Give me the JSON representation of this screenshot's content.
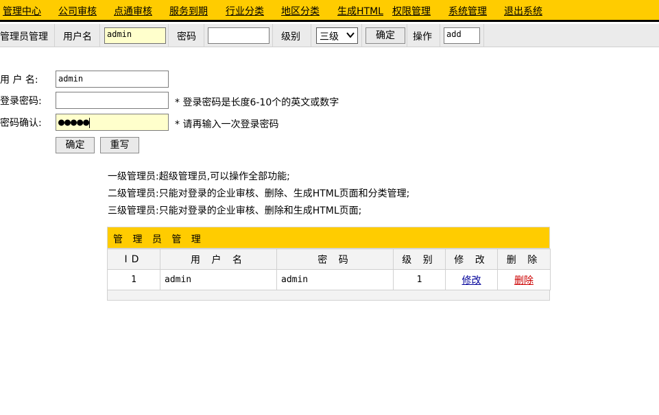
{
  "nav": {
    "items": [
      "管理中心",
      "公司审核",
      "点通审核",
      "服务到期",
      "行业分类",
      "地区分类",
      "生成HTML",
      "权限管理",
      "系统管理",
      "退出系统"
    ]
  },
  "toolbar": {
    "section_label": "管理员管理",
    "username_label": "用户名",
    "username_value": "admin",
    "password_label": "密码",
    "password_value": "",
    "level_label": "级别",
    "level_selected": "三级",
    "confirm_label": "确定",
    "operation_label": "操作",
    "operation_value": "add"
  },
  "form": {
    "username_label": "用 户 名:",
    "username_value": "admin",
    "password_label": "登录密码:",
    "password_value": "",
    "password_hint": "* 登录密码是长度6-10个的英文或数字",
    "confirm_label": "密码确认:",
    "confirm_value": "●●●●●",
    "confirm_hint": "* 请再输入一次登录密码",
    "submit_label": "确定",
    "reset_label": "重写"
  },
  "descriptions": [
    "一级管理员:超级管理员,可以操作全部功能;",
    "二级管理员:只能对登录的企业审核、删除、生成HTML页面和分类管理;",
    "三级管理员:只能对登录的企业审核、删除和生成HTML页面;"
  ],
  "table": {
    "title": "管 理 员 管 理",
    "headers": [
      "ID",
      "用 户 名",
      "密 码",
      "级 别",
      "修 改",
      "删 除"
    ],
    "rows": [
      {
        "id": "1",
        "username": "admin",
        "password": "admin",
        "level": "1",
        "edit": "修改",
        "delete": "删除"
      }
    ]
  },
  "colors": {
    "nav_bg": "#ffcc00",
    "edit_link": "#000099",
    "delete_link": "#cc0000",
    "input_highlight": "#ffffcc"
  }
}
